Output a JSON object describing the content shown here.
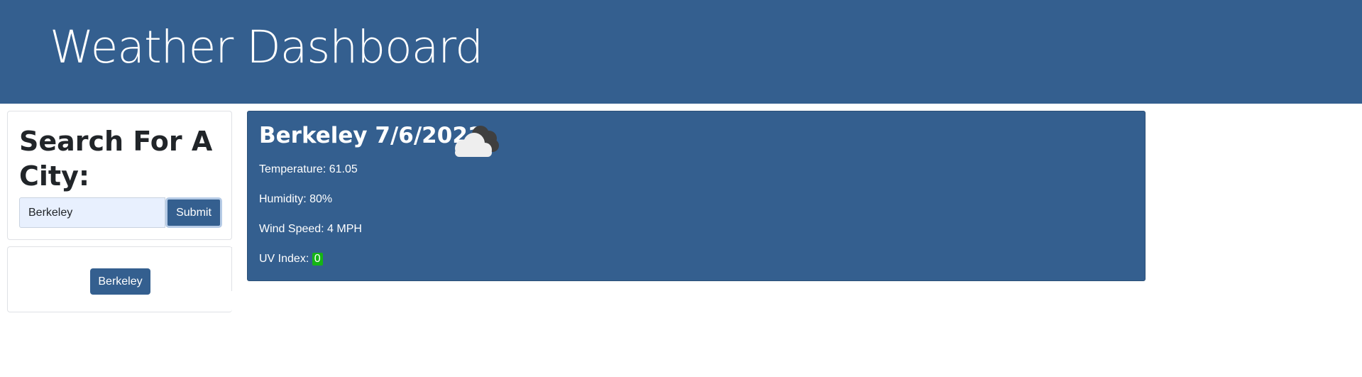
{
  "header": {
    "title": "Weather Dashboard"
  },
  "search": {
    "heading": "Search For A City:",
    "input_value": "Berkeley",
    "submit_label": "Submit"
  },
  "history": {
    "items": [
      {
        "label": "Berkeley"
      }
    ]
  },
  "current": {
    "title": "Berkeley 7/6/2021",
    "icon": "cloudy-icon",
    "temperature": "Temperature: 61.05",
    "humidity": "Humidity: 80%",
    "wind": "Wind Speed: 4 MPH",
    "uv_label": "UV Index: ",
    "uv_value": "0",
    "uv_color": "#15b515"
  },
  "colors": {
    "brand": "#345f8f"
  }
}
